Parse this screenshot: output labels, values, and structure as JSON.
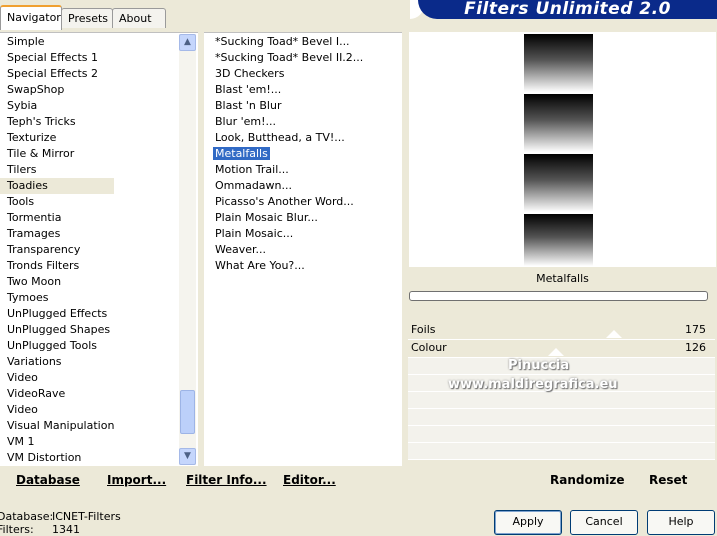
{
  "tabs": [
    "Navigator",
    "Presets",
    "About"
  ],
  "banner_title": "Filters Unlimited 2.0",
  "categories": [
    "Simple",
    "Special Effects 1",
    "Special Effects 2",
    "SwapShop",
    "Sybia",
    "Teph's Tricks",
    "Texturize",
    "Tile & Mirror",
    "Tilers",
    "Toadies",
    "Tools",
    "Tormentia",
    "Tramages",
    "Transparency",
    "Tronds Filters",
    "Two Moon",
    "Tymoes",
    "UnPlugged Effects",
    "UnPlugged Shapes",
    "UnPlugged Tools",
    "Variations",
    "Video",
    "VideoRave",
    "Video",
    "Visual Manipulation",
    "VM 1",
    "VM Distortion"
  ],
  "selected_category": "Toadies",
  "filters": [
    "*Sucking Toad*  Bevel I...",
    "*Sucking Toad*  Bevel II.2...",
    "3D Checkers",
    "Blast 'em!...",
    "Blast 'n Blur",
    "Blur 'em!...",
    "Look, Butthead, a TV!...",
    "Metalfalls",
    "Motion Trail...",
    "Ommadawn...",
    "Picasso's Another Word...",
    "Plain Mosaic Blur...",
    "Plain Mosaic...",
    "Weaver...",
    "What Are You?..."
  ],
  "selected_filter": "Metalfalls",
  "left_buttons": {
    "database": "Database",
    "import": "Import...",
    "filter_info": "Filter Info...",
    "editor": "Editor..."
  },
  "preview_title": "Metalfalls",
  "params": [
    {
      "label": "Foils",
      "value": "175"
    },
    {
      "label": "Colour",
      "value": "126"
    }
  ],
  "watermark": {
    "line1": "Pinuccia",
    "line2": "www.maldiregrafica.eu"
  },
  "right_buttons": {
    "randomize": "Randomize",
    "reset": "Reset"
  },
  "status": {
    "database_label": "Database:",
    "database_value": "ICNET-Filters",
    "filters_label": "Filters:",
    "filters_value": "1341"
  },
  "dialog_buttons": {
    "apply": "Apply",
    "cancel": "Cancel",
    "help": "Help"
  }
}
